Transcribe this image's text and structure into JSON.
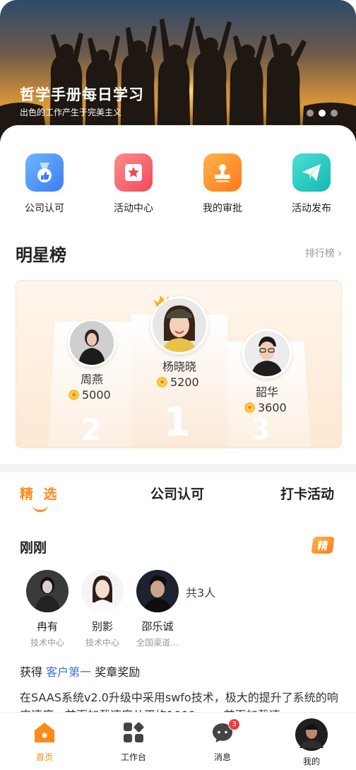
{
  "banner": {
    "title": "哲学手册每日学习",
    "subtitle": "出色的工作产生于完美主义",
    "slides_total": 3,
    "active_slide": 2
  },
  "quick": [
    {
      "label": "公司认可",
      "icon": "medal-thumbs-up-icon",
      "color": "#3b7df2"
    },
    {
      "label": "活动中心",
      "icon": "star-calendar-icon",
      "color": "#f04a5a"
    },
    {
      "label": "我的审批",
      "icon": "stamp-icon",
      "color": "#ff7a1a"
    },
    {
      "label": "活动发布",
      "icon": "paper-plane-icon",
      "color": "#14b8b0"
    }
  ],
  "star_board": {
    "title": "明星榜",
    "more": "排行榜 ›",
    "ranks": [
      {
        "rank": "2",
        "name": "周燕",
        "score": "5000"
      },
      {
        "rank": "1",
        "name": "杨晓晓",
        "score": "5200"
      },
      {
        "rank": "3",
        "name": "韶华",
        "score": "3600"
      }
    ]
  },
  "tabs": [
    {
      "label": "精 选",
      "active": true
    },
    {
      "label": "公司认可",
      "active": false
    },
    {
      "label": "打卡活动",
      "active": false
    }
  ],
  "feed": {
    "time": "刚刚",
    "badge": "精",
    "people": [
      {
        "name": "冉有",
        "dept": "技术中心"
      },
      {
        "name": "别影",
        "dept": "技术中心"
      },
      {
        "name": "邵乐诚",
        "dept": "全国渠道…"
      }
    ],
    "count": "共3人",
    "award_prefix": "获得",
    "award_link": "客户第一",
    "award_suffix": "奖章奖励",
    "description": "在SAAS系统v2.0升级中采用swfo技术，极大的提升了系统的响应速度，首页加载速度从平均1000ms，首页加载速"
  },
  "nav": [
    {
      "label": "首页",
      "icon": "home-icon",
      "active": true
    },
    {
      "label": "工作台",
      "icon": "workbench-grid-icon",
      "active": false
    },
    {
      "label": "消息",
      "icon": "message-bubble-icon",
      "active": false,
      "badge": "3"
    },
    {
      "label": "我的",
      "icon": "user-avatar",
      "active": false
    }
  ],
  "colors": {
    "accent": "#ff8a1a",
    "link": "#3b6fd8",
    "badge_red": "#f03a3a"
  }
}
